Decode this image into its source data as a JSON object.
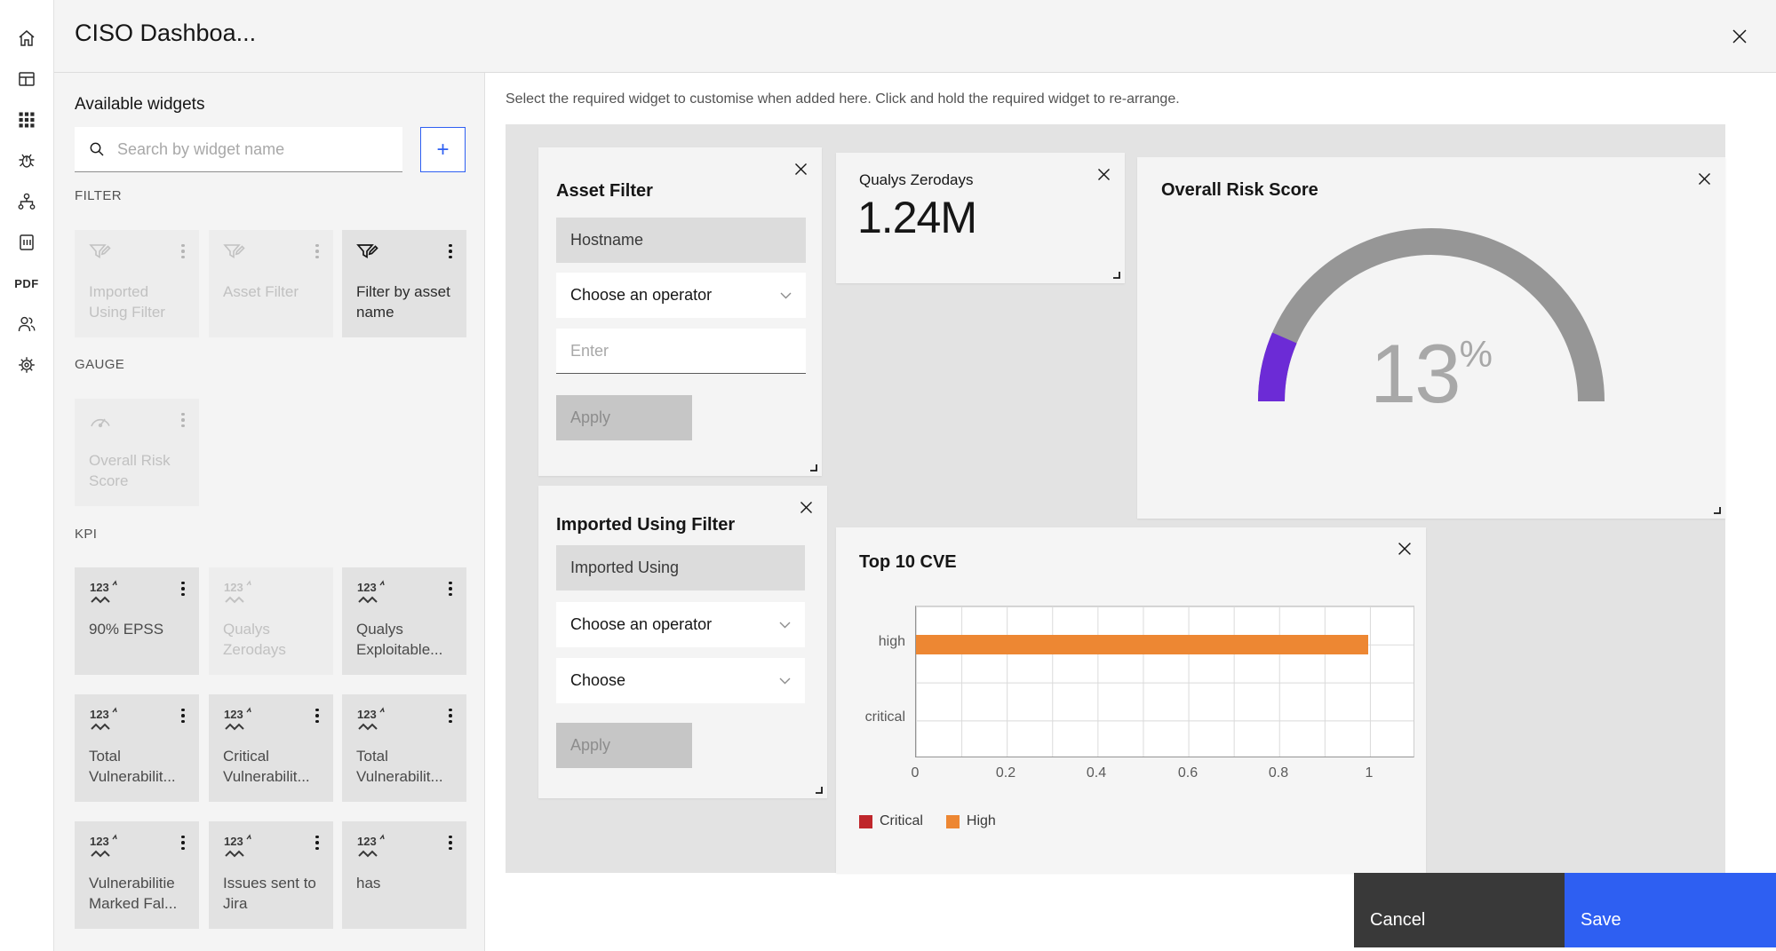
{
  "header": {
    "title": "CISO Dashboa..."
  },
  "rail": {
    "icons": [
      "home-icon",
      "dashboard-icon",
      "apps-grid-icon",
      "bug-icon",
      "flow-icon",
      "report-icon",
      "pdf-icon",
      "users-icon",
      "settings-gear-icon"
    ]
  },
  "panel": {
    "title": "Available widgets",
    "search_placeholder": "Search by widget name",
    "add_label": "+",
    "sections": [
      {
        "heading": "FILTER",
        "cards": [
          {
            "label": "Imported Using Filter",
            "enabled": false
          },
          {
            "label": "Asset Filter",
            "enabled": false
          },
          {
            "label": "Filter by asset name",
            "enabled": true
          }
        ]
      },
      {
        "heading": "GAUGE",
        "cards": [
          {
            "label": "Overall Risk Score",
            "enabled": false
          }
        ]
      },
      {
        "heading": "KPI",
        "cards": [
          {
            "label": "90% EPSS",
            "enabled": true
          },
          {
            "label": "Qualys Zerodays",
            "enabled": false
          },
          {
            "label": "Qualys Exploitable...",
            "enabled": true
          },
          {
            "label": "Total Vulnerabilit...",
            "enabled": true
          },
          {
            "label": "Critical Vulnerabilit...",
            "enabled": true
          },
          {
            "label": "Total Vulnerabilit...",
            "enabled": true
          },
          {
            "label": "Vulnerabilitie Marked Fal...",
            "enabled": true
          },
          {
            "label": "Issues sent to Jira",
            "enabled": true
          },
          {
            "label": "has",
            "enabled": true
          }
        ]
      }
    ]
  },
  "main": {
    "instruction": "Select the required widget to customise when added here. Click and hold the required widget to re-arrange."
  },
  "widgets": {
    "asset_filter": {
      "title": "Asset Filter",
      "field": "Hostname",
      "operator_placeholder": "Choose an operator",
      "value_placeholder": "Enter",
      "apply_label": "Apply"
    },
    "qualys_zerodays": {
      "title": "Qualys Zerodays",
      "value": "1.24M"
    },
    "overall_risk_score": {
      "title": "Overall Risk Score",
      "value": "13",
      "unit": "%"
    },
    "imported_using_filter": {
      "title": "Imported Using Filter",
      "field": "Imported Using",
      "operator_placeholder": "Choose an operator",
      "choose_placeholder": "Choose",
      "apply_label": "Apply"
    },
    "top_10_cve": {
      "title": "Top 10 CVE"
    }
  },
  "chart_data": [
    {
      "type": "gauge",
      "title": "Overall Risk Score",
      "value": 13,
      "min": 0,
      "max": 100,
      "unit": "%",
      "fill_color": "#6c2bd6",
      "track_color": "#969696"
    },
    {
      "type": "bar",
      "orientation": "horizontal",
      "title": "Top 10 CVE",
      "categories": [
        "high",
        "critical"
      ],
      "series": [
        {
          "name": "Critical",
          "color": "#bf262b",
          "values": [
            0,
            0
          ]
        },
        {
          "name": "High",
          "color": "#ed8733",
          "values": [
            1,
            0
          ]
        }
      ],
      "xticks": [
        "0",
        "0.2",
        "0.4",
        "0.6",
        "0.8",
        "1"
      ],
      "xlim": [
        0,
        1.1
      ],
      "grid": true,
      "legend_position": "bottom"
    }
  ],
  "footer": {
    "cancel_label": "Cancel",
    "save_label": "Save",
    "accent_blue": "#2e5ff2",
    "cancel_color": "#393939"
  }
}
